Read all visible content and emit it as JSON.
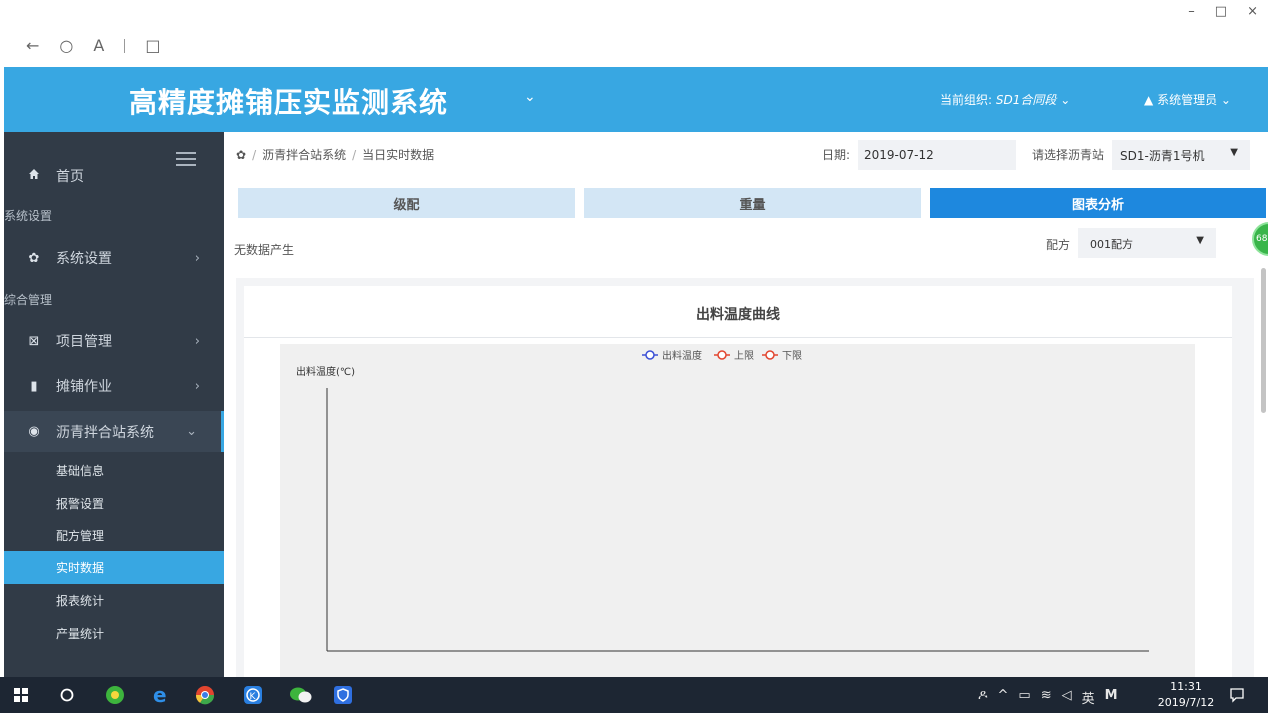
{
  "window": {
    "minimize": "–",
    "restore": "□",
    "close": "×"
  },
  "browser_nav": {
    "back": "←",
    "refresh": "○",
    "reader": "A",
    "tabs": "□"
  },
  "header": {
    "title": "高精度摊铺压实监测系统",
    "title_caret": "⌄",
    "org_label": "当前组织:",
    "org_value": "SD1合同段",
    "org_caret": "⌄",
    "user_icon": "▲",
    "user_name": "系统管理员",
    "user_caret": "⌄"
  },
  "sidebar": {
    "home": {
      "icon": "home-icon",
      "label": "首页"
    },
    "section_settings": "系统设置",
    "settings": {
      "icon": "gear-icon",
      "label": "系统设置",
      "arrow": "›"
    },
    "section_manage": "综合管理",
    "project": {
      "icon": "project-icon",
      "label": "项目管理",
      "arrow": "›"
    },
    "paving": {
      "icon": "paving-icon",
      "label": "摊铺作业",
      "arrow": "›"
    },
    "asphalt": {
      "icon": "globe-icon",
      "label": "沥青拌合站系统",
      "arrow": "⌄"
    },
    "sub_items": [
      "基础信息",
      "报警设置",
      "配方管理",
      "实时数据",
      "报表统计",
      "产量统计"
    ],
    "active_sub_index": 3
  },
  "breadcrumb": {
    "items": [
      "沥青拌合站系统",
      "当日实时数据"
    ],
    "separator": "/"
  },
  "filters": {
    "date_label": "日期:",
    "date_value": "2019-07-12",
    "station_label": "请选择沥青站",
    "station_value": "SD1-沥青1号机",
    "recipe_label": "配方",
    "recipe_value": "001配方"
  },
  "tabs": [
    "级配",
    "重量",
    "图表分析"
  ],
  "active_tab": 2,
  "no_data_text": "无数据产生",
  "badge_text": "68",
  "chart_data": {
    "type": "line",
    "title": "出料温度曲线",
    "ylabel": "出料温度(℃)",
    "xlabel": "",
    "series": [
      {
        "name": "出料温度",
        "color": "#3b4fd6",
        "values": []
      },
      {
        "name": "上限",
        "color": "#e2452f",
        "values": []
      },
      {
        "name": "下限",
        "color": "#e2452f",
        "values": []
      }
    ],
    "legend_position": "top-center",
    "grid": false
  },
  "taskbar": {
    "tray_icons": [
      "person-icon",
      "chevron-up-icon",
      "battery-icon",
      "wifi-icon",
      "volume-icon"
    ],
    "ime": "英",
    "ime_m": "M",
    "time": "11:31",
    "date": "2019/7/12"
  }
}
